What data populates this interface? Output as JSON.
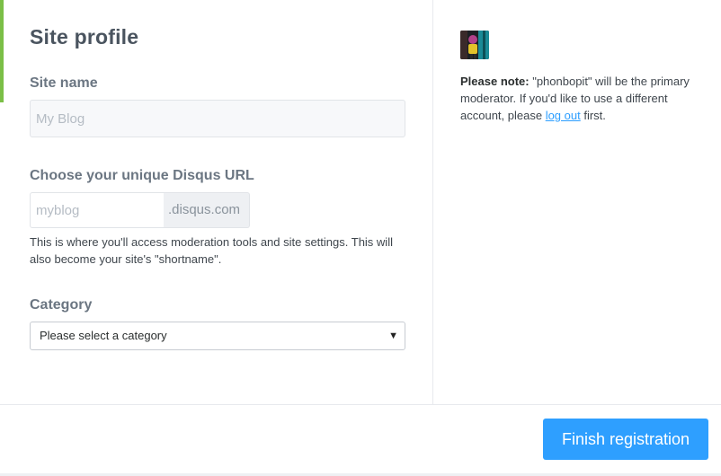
{
  "form": {
    "title": "Site profile",
    "site_name": {
      "label": "Site name",
      "placeholder": "My Blog",
      "value": ""
    },
    "url": {
      "label": "Choose your unique Disqus URL",
      "placeholder": "myblog",
      "suffix": ".disqus.com",
      "help": "This is where you'll access moderation tools and site settings. This will also become your site's \"shortname\"."
    },
    "category": {
      "label": "Category",
      "selected": "Please select a category"
    }
  },
  "sidebar": {
    "note_bold": "Please note:",
    "note_before_link": " \"phonbopit\" will be the primary moderator. If you'd like to use a different account, please ",
    "note_link": "log out",
    "note_after_link": " first."
  },
  "footer": {
    "finish_label": "Finish registration"
  },
  "colors": {
    "accent": "#2e9fff",
    "brand_green": "#7bbf47"
  }
}
